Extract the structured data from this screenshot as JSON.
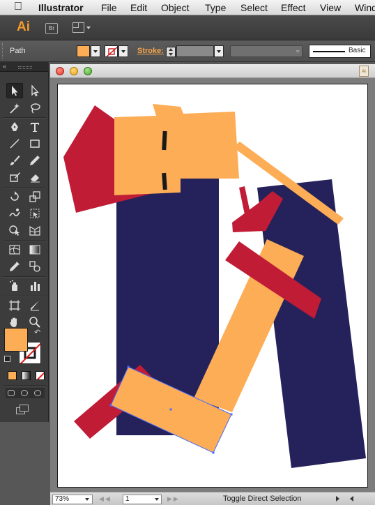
{
  "menubar": {
    "apple_icon": "apple-logo-icon",
    "items": [
      "Illustrator",
      "File",
      "Edit",
      "Object",
      "Type",
      "Select",
      "Effect",
      "View",
      "Wind"
    ]
  },
  "appbar": {
    "app_logo": "Ai",
    "bridge_label": "Br"
  },
  "controlbar": {
    "selection_label": "Path",
    "fill_color": "#fcad56",
    "stroke_label": "Stroke:",
    "brush_label": "Basic"
  },
  "document": {
    "doc_icon_label": "Ai",
    "zoom": "73%",
    "page_number": "1",
    "status_text": "Toggle Direct Selection"
  },
  "colors": {
    "orange": "#fcad56",
    "red": "#c01c36",
    "navy": "#25225b",
    "selection_blue": "#4a6cff",
    "panel": "#3c3c3c"
  },
  "tools": [
    "selection-tool",
    "direct-selection-tool",
    "magic-wand-tool",
    "lasso-tool",
    "pen-tool",
    "type-tool",
    "line-tool",
    "rectangle-tool",
    "paintbrush-tool",
    "pencil-tool",
    "blob-brush-tool",
    "eraser-tool",
    "rotate-tool",
    "scale-tool",
    "warp-tool",
    "free-transform-tool",
    "shape-builder-tool",
    "perspective-grid-tool",
    "mesh-tool",
    "gradient-tool",
    "eyedropper-tool",
    "blend-tool",
    "symbol-sprayer-tool",
    "column-graph-tool",
    "artboard-tool",
    "slice-tool",
    "hand-tool",
    "zoom-tool"
  ]
}
